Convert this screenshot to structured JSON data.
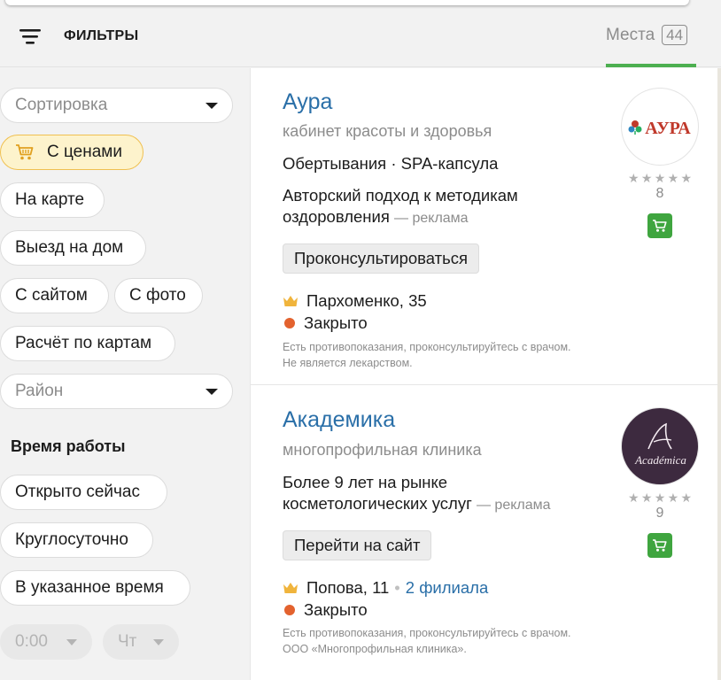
{
  "header": {
    "filters_label": "ФИЛЬТРЫ",
    "tab_places_label": "Места",
    "tab_places_count": "44"
  },
  "filters": {
    "sort_placeholder": "Сортировка",
    "with_prices": "С ценами",
    "on_map": "На карте",
    "home_visit": "Выезд на дом",
    "with_site": "С сайтом",
    "with_photo": "С фото",
    "card_payment": "Расчёт по картам",
    "district_placeholder": "Район",
    "work_time_title": "Время работы",
    "open_now": "Открыто сейчас",
    "round_the_clock": "Круглосуточно",
    "at_time": "В указанное время",
    "time_value": "0:00",
    "day_value": "Чт"
  },
  "results": [
    {
      "name": "Аура",
      "category": "кабинет красоты и здоровья",
      "services": "Обертывания · SPA-капсула",
      "promo_line1": "Авторский подход к методикам",
      "promo_line2": "оздоровления",
      "ad_label": "— реклама",
      "action_label": "Проконсультироваться",
      "address": "Пархоменко, 35",
      "branches": "",
      "status": "Закрыто",
      "disclaimer_line1": "Есть противопоказания, проконсультируйтесь с врачом.",
      "disclaimer_line2": "Не является лекарством.",
      "logo_text": "АУРА",
      "rating_count": "8"
    },
    {
      "name": "Академика",
      "category": "многопрофильная клиника",
      "services": "",
      "promo_line1": "Более 9 лет на рынке",
      "promo_line2": "косметологических услуг",
      "ad_label": "— реклама",
      "action_label": "Перейти на сайт",
      "address": "Попова, 11",
      "branches": "2 филиала",
      "status": "Закрыто",
      "disclaimer_line1": "Есть противопоказания, проконсультируйтесь с врачом.",
      "disclaimer_line2": "ООО «Многопрофильная клиника».",
      "logo_text": "Académica",
      "rating_count": "9"
    }
  ],
  "colors": {
    "accent_green": "#4caf50",
    "link_blue": "#2a6fa8",
    "closed_dot": "#e3622e",
    "active_chip_bg": "#fdf3cc",
    "cart_badge": "#3fa53f",
    "crown": "#f0b43c"
  },
  "icons": {
    "filter": "filter-lines-icon",
    "cart": "cart-icon",
    "crown": "crown-icon",
    "caret": "caret-down-icon",
    "star": "star-icon"
  }
}
